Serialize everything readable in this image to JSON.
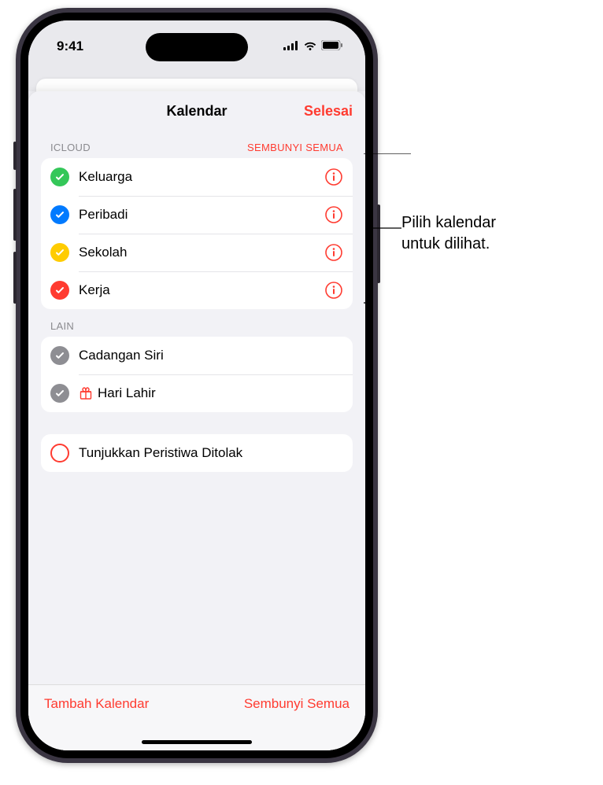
{
  "status": {
    "time": "9:41"
  },
  "header": {
    "title": "Kalendar",
    "done": "Selesai"
  },
  "sections": {
    "icloud": {
      "label": "ICLOUD",
      "action": "SEMBUNYI SEMUA",
      "items": [
        {
          "label": "Keluarga",
          "color": "#34c759"
        },
        {
          "label": "Peribadi",
          "color": "#007aff"
        },
        {
          "label": "Sekolah",
          "color": "#ffcc00"
        },
        {
          "label": "Kerja",
          "color": "#ff3b30"
        }
      ]
    },
    "lain": {
      "label": "LAIN",
      "items": [
        {
          "label": "Cadangan Siri",
          "color": "#8e8e93"
        },
        {
          "label": "Hari Lahir",
          "color": "#8e8e93",
          "icon": "gift"
        }
      ]
    },
    "declined": {
      "label": "Tunjukkan Peristiwa Ditolak"
    }
  },
  "toolbar": {
    "add": "Tambah Kalendar",
    "hide_all": "Sembunyi Semua"
  },
  "callout": {
    "line1": "Pilih kalendar",
    "line2": "untuk dilihat."
  }
}
